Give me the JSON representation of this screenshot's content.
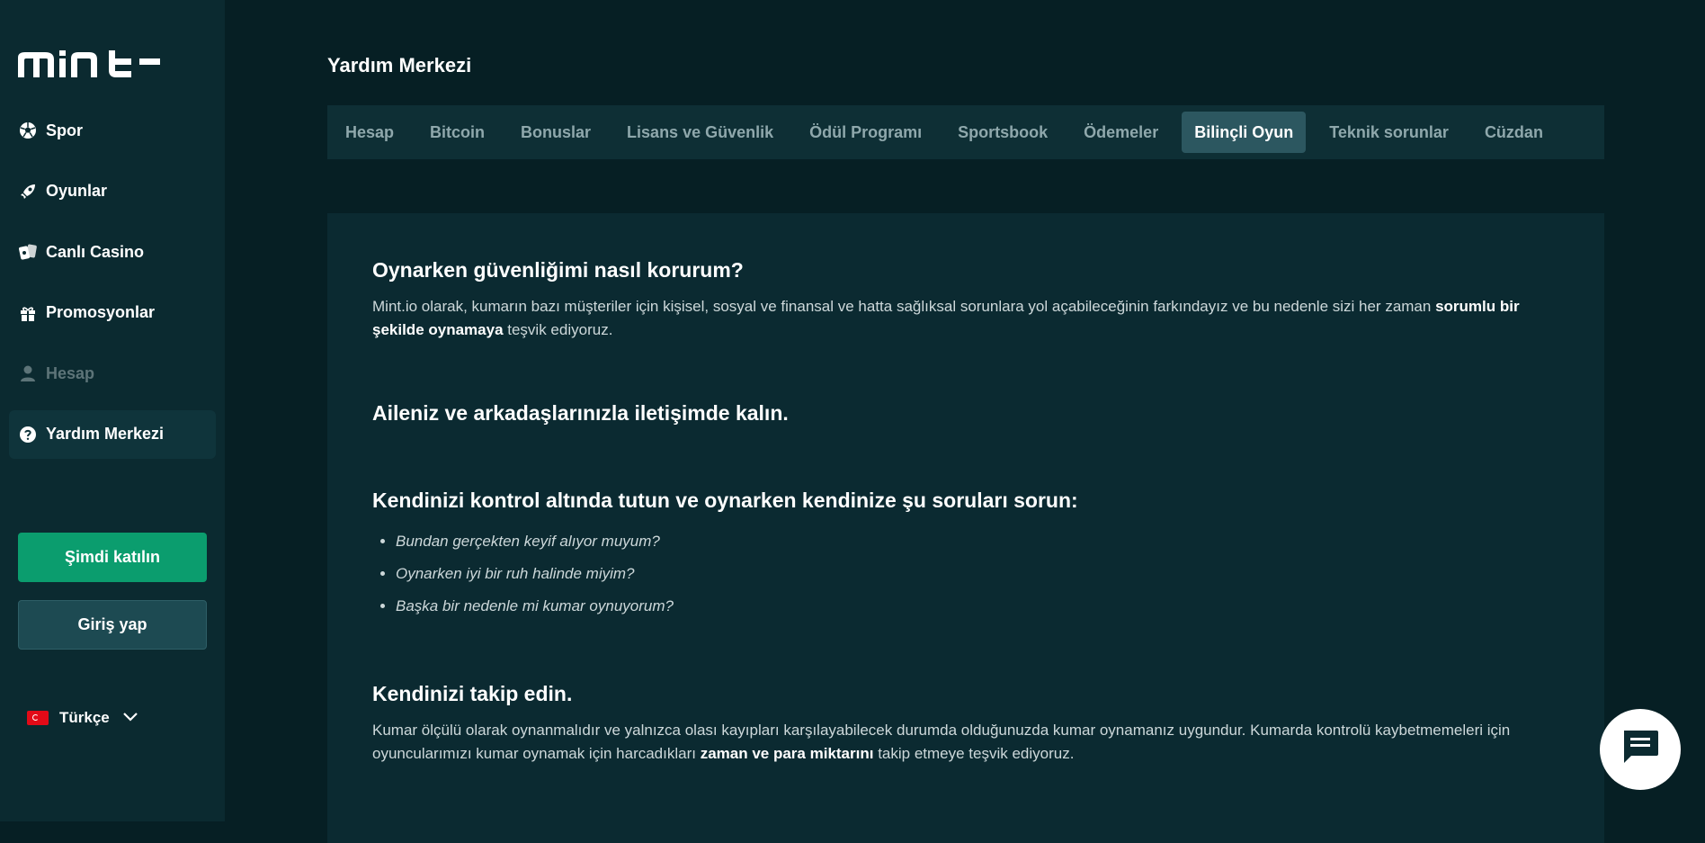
{
  "brand": {
    "logo_text": "mint"
  },
  "sidebar": {
    "items": [
      {
        "label": "Spor",
        "icon": "soccer-ball-icon"
      },
      {
        "label": "Oyunlar",
        "icon": "rocket-icon"
      },
      {
        "label": "Canlı Casino",
        "icon": "cards-icon"
      },
      {
        "label": "Promosyonlar",
        "icon": "gift-icon"
      },
      {
        "label": "Hesap",
        "icon": "user-icon"
      },
      {
        "label": "Yardım Merkezi",
        "icon": "help-icon"
      }
    ],
    "join_label": "Şimdi katılın",
    "login_label": "Giriş yap",
    "language": "Türkçe"
  },
  "main": {
    "title": "Yardım Merkezi",
    "tabs": [
      {
        "label": "Hesap"
      },
      {
        "label": "Bitcoin"
      },
      {
        "label": "Bonuslar"
      },
      {
        "label": "Lisans ve Güvenlik"
      },
      {
        "label": "Ödül Programı"
      },
      {
        "label": "Sportsbook"
      },
      {
        "label": "Ödemeler"
      },
      {
        "label": "Bilinçli Oyun"
      },
      {
        "label": "Teknik sorunlar"
      },
      {
        "label": "Cüzdan"
      }
    ],
    "active_tab": "Bilinçli Oyun",
    "article": {
      "h1": "Oynarken güvenliğimi nasıl korurum?",
      "p1_a": "Mint.io olarak, kumarın bazı müşteriler için kişisel, sosyal ve finansal ve hatta sağlıksal sorunlara yol açabileceğinin farkındayız ve bu nedenle sizi her zaman ",
      "p1_bold": "sorumlu bir şekilde oynamaya",
      "p1_b": " teşvik ediyoruz.",
      "h2": "Aileniz ve arkadaşlarınızla iletişimde kalın.",
      "h3": "Kendinizi kontrol altında tutun ve oynarken kendinize şu soruları sorun:",
      "questions": [
        "Bundan gerçekten keyif alıyor muyum?",
        "Oynarken iyi bir ruh halinde miyim?",
        "Başka bir nedenle mi kumar oynuyorum?"
      ],
      "h4": "Kendinizi takip edin.",
      "p2_a": "Kumar ölçülü olarak oynanmalıdır ve yalnızca olası kayıpları karşılayabilecek durumda olduğunuzda kumar oynamanız uygundur. Kumarda kontrolü kaybetmemeleri için oyuncularımızı kumar oynamak için harcadıkları ",
      "p2_bold": "zaman ve para miktarını",
      "p2_b": " takip etmeye teşvik ediyoruz."
    }
  },
  "colors": {
    "accent": "#0b9d6e",
    "active_tab": "#2c5760",
    "sidebar": "#0b2a30"
  }
}
